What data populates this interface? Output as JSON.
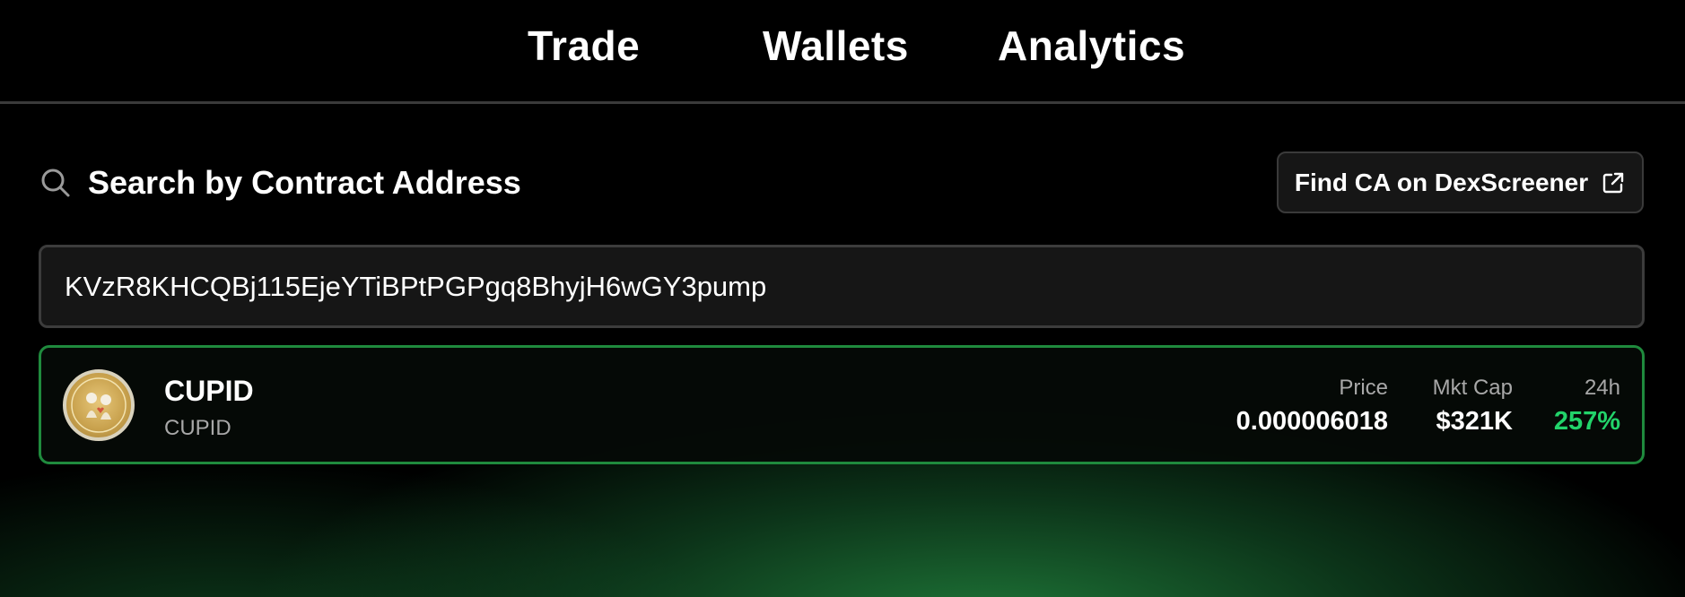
{
  "nav": {
    "tabs": [
      {
        "label": "Trade"
      },
      {
        "label": "Wallets"
      },
      {
        "label": "Analytics"
      }
    ]
  },
  "search": {
    "title": "Search by Contract Address",
    "icon": "search-icon",
    "find_button_label": "Find CA on DexScreener",
    "find_button_icon": "external-link-icon",
    "input_value": "KVzR8KHCQBj115EjeYTiBPtPGPgq8BhyjH6wGY3pump"
  },
  "result": {
    "name": "CUPID",
    "symbol": "CUPID",
    "price_label": "Price",
    "price_value": "0.000006018",
    "mktcap_label": "Mkt Cap",
    "mktcap_value": "$321K",
    "change_label": "24h",
    "change_value": "257%"
  },
  "colors": {
    "accent_green": "#22d36a",
    "border_green": "#1f8a3d",
    "background": "#000000"
  }
}
